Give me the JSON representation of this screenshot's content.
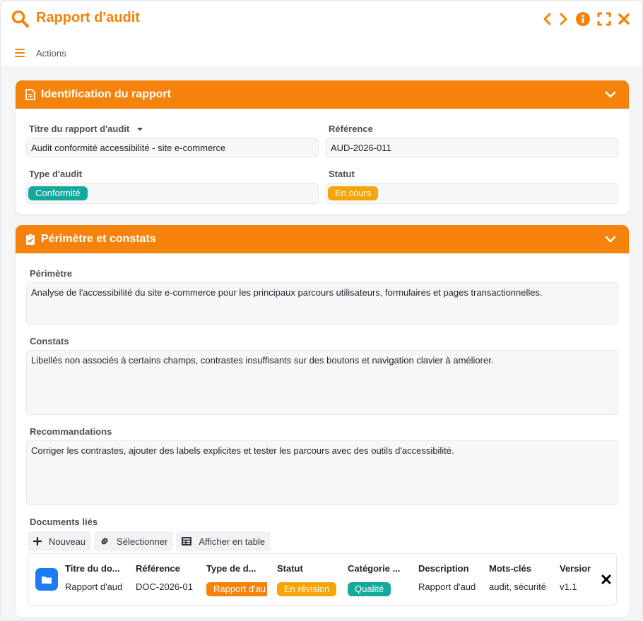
{
  "window": {
    "title": "Rapport d'audit",
    "accent_color": "#f5820b"
  },
  "toolbar": {
    "actions_label": "Actions"
  },
  "section1": {
    "title": "Identification du rapport",
    "icon": "document-icon",
    "fields": {
      "titre_label": "Titre du rapport d'audit",
      "titre_value": "Audit conformité accessibilité - site e-commerce",
      "reference_label": "Référence",
      "reference_value": "AUD-2026-011",
      "type_label": "Type d'audit",
      "type_value": "Conformité",
      "type_color": "#14a99a",
      "statut_label": "Statut",
      "statut_value": "En cours",
      "statut_color": "#f5a508"
    }
  },
  "section2": {
    "title": "Périmètre et constats",
    "icon": "clipboard-check-icon",
    "perimetre_label": "Périmètre",
    "perimetre_value": "Analyse de l'accessibilité du site e-commerce pour les principaux parcours utilisateurs, formulaires et pages transactionnelles.",
    "constats_label": "Constats",
    "constats_value": "Libellés non associés à certains champs, contrastes insuffisants sur des boutons et navigation clavier à améliorer.",
    "recommandations_label": "Recommandations",
    "recommandations_value": "Corriger les contrastes, ajouter des labels explicites et tester les parcours avec des outils d'accessibilité.",
    "documents_label": "Documents liés",
    "doc_buttons": {
      "new": "Nouveau",
      "select": "Sélectionner",
      "table": "Afficher en table"
    },
    "doc_table": {
      "headers": [
        "Titre du do...",
        "Référence",
        "Type de d...",
        "Statut",
        "Catégorie ...",
        "Description",
        "Mots-clés",
        "Version"
      ],
      "row": {
        "title": "Rapport d'aud",
        "reference": "DOC-2026-01",
        "type": "Rapport d'au",
        "statut": "En révision",
        "categorie": "Qualité",
        "description": "Rapport d'aud",
        "mots_cles": "audit, sécurité",
        "version": "v1.1"
      }
    }
  }
}
